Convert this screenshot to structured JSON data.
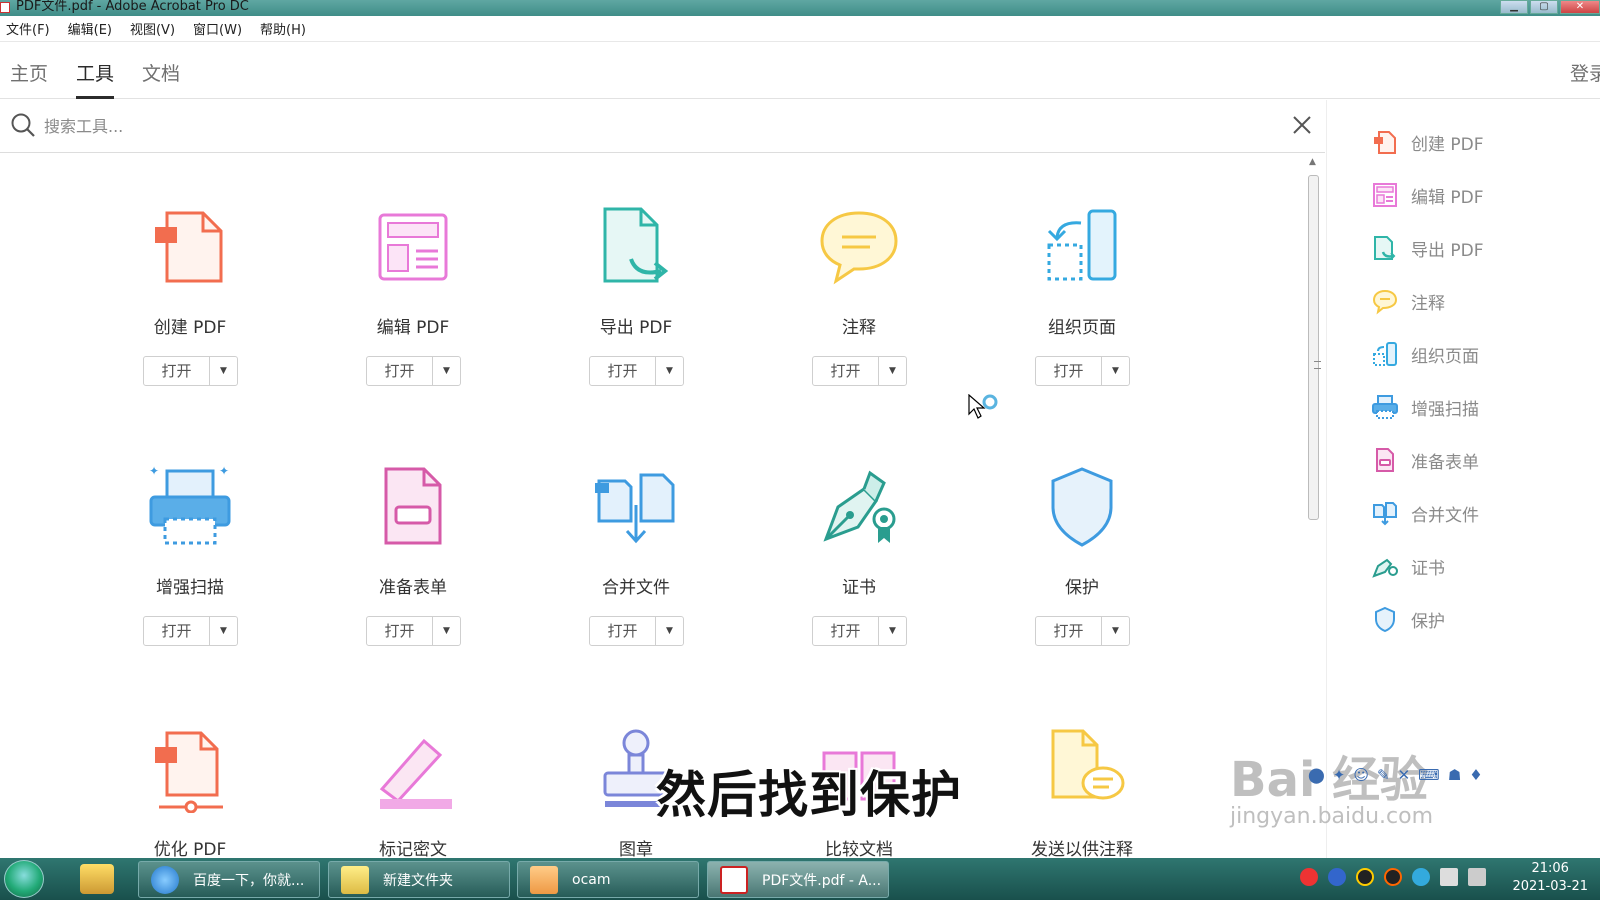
{
  "window": {
    "title": "PDF文件.pdf - Adobe Acrobat Pro DC"
  },
  "menu": [
    "文件(F)",
    "编辑(E)",
    "视图(V)",
    "窗口(W)",
    "帮助(H)"
  ],
  "tabs": [
    {
      "label": "主页",
      "active": false
    },
    {
      "label": "工具",
      "active": true
    },
    {
      "label": "文档",
      "active": false
    }
  ],
  "signin": "登录",
  "search": {
    "placeholder": "搜索工具..."
  },
  "open_label": "打开",
  "tools": [
    {
      "name": "创建 PDF",
      "icon": "create-pdf-icon",
      "color": "#f26d4f"
    },
    {
      "name": "编辑 PDF",
      "icon": "edit-pdf-icon",
      "color": "#e879d8"
    },
    {
      "name": "导出 PDF",
      "icon": "export-pdf-icon",
      "color": "#2fb5a8"
    },
    {
      "name": "注释",
      "icon": "comment-icon",
      "color": "#f6c844"
    },
    {
      "name": "组织页面",
      "icon": "organize-pages-icon",
      "color": "#35a9e0"
    },
    {
      "name": "增强扫描",
      "icon": "enhance-scan-icon",
      "color": "#3e9be0"
    },
    {
      "name": "准备表单",
      "icon": "prepare-form-icon",
      "color": "#d65aa8"
    },
    {
      "name": "合并文件",
      "icon": "combine-files-icon",
      "color": "#3e9be0"
    },
    {
      "name": "证书",
      "icon": "certificate-icon",
      "color": "#2a9d8f"
    },
    {
      "name": "保护",
      "icon": "protect-shield-icon",
      "color": "#3e9be0"
    },
    {
      "name": "优化 PDF",
      "icon": "optimize-pdf-icon",
      "color": "#f26d4f"
    },
    {
      "name": "标记密文",
      "icon": "redact-icon",
      "color": "#e879d8"
    },
    {
      "name": "图章",
      "icon": "stamp-icon",
      "color": "#7b86d9"
    },
    {
      "name": "比较文档",
      "icon": "compare-documents-icon",
      "color": "#e879d8"
    },
    {
      "name": "发送以供注释",
      "icon": "send-for-comments-icon",
      "color": "#f6c844"
    }
  ],
  "right_panel": [
    {
      "label": "创建 PDF",
      "icon": "create-pdf-icon"
    },
    {
      "label": "编辑 PDF",
      "icon": "edit-pdf-icon"
    },
    {
      "label": "导出 PDF",
      "icon": "export-pdf-icon"
    },
    {
      "label": "注释",
      "icon": "comment-icon"
    },
    {
      "label": "组织页面",
      "icon": "organize-pages-icon"
    },
    {
      "label": "增强扫描",
      "icon": "enhance-scan-icon"
    },
    {
      "label": "准备表单",
      "icon": "prepare-form-icon"
    },
    {
      "label": "合并文件",
      "icon": "combine-files-icon"
    },
    {
      "label": "证书",
      "icon": "certificate-icon"
    },
    {
      "label": "保护",
      "icon": "protect-shield-icon"
    }
  ],
  "subtitle": "然后找到保护",
  "watermark": {
    "line1": "Bai 经验",
    "line2": "jingyan.baidu.com"
  },
  "taskbar": {
    "items": [
      {
        "label": "百度一下，你就...",
        "active": false
      },
      {
        "label": "新建文件夹",
        "active": false
      },
      {
        "label": "ocam",
        "active": false
      },
      {
        "label": "PDF文件.pdf - A...",
        "active": true
      }
    ],
    "time": "21:06",
    "date": "2021-03-21"
  }
}
